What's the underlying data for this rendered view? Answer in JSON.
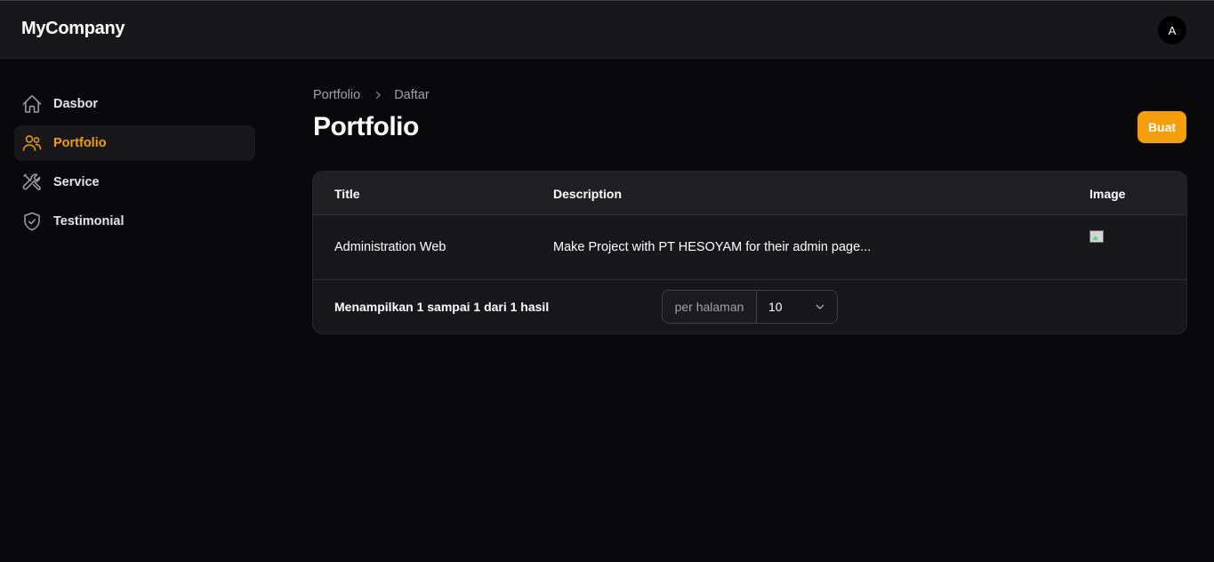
{
  "header": {
    "brand": "MyCompany",
    "avatar_initial": "A"
  },
  "sidebar": {
    "items": [
      {
        "label": "Dasbor",
        "icon": "home-icon",
        "active": false
      },
      {
        "label": "Portfolio",
        "icon": "users-icon",
        "active": true
      },
      {
        "label": "Service",
        "icon": "tools-icon",
        "active": false
      },
      {
        "label": "Testimonial",
        "icon": "shield-check-icon",
        "active": false
      }
    ]
  },
  "breadcrumb": {
    "items": [
      "Portfolio",
      "Daftar"
    ]
  },
  "page": {
    "title": "Portfolio",
    "create_label": "Buat"
  },
  "table": {
    "columns": [
      "Title",
      "Description",
      "Image"
    ],
    "rows": [
      {
        "title": "Administration Web",
        "description": "Make Project with PT HESOYAM for their admin page...",
        "image": "broken-image-icon"
      }
    ]
  },
  "pagination": {
    "result_text": "Menampilkan 1 sampai 1 dari 1 hasil",
    "per_page_label": "per halaman",
    "per_page_value": "10"
  },
  "colors": {
    "background": "#09090b",
    "surface": "#18181b",
    "accent": "#f59e0b",
    "muted_text": "#a1a1aa"
  }
}
